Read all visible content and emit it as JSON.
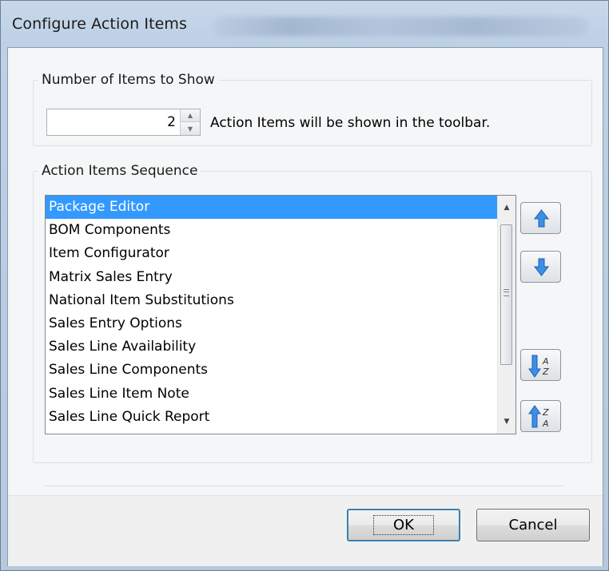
{
  "window": {
    "title": "Configure Action Items"
  },
  "number_group": {
    "legend": "Number of Items to Show",
    "count_value": "2",
    "caption": "Action Items will be shown in the toolbar."
  },
  "sequence_group": {
    "legend": "Action Items Sequence",
    "items": [
      "Package Editor",
      "BOM Components",
      "Item Configurator",
      "Matrix Sales Entry",
      "National Item Substitutions",
      "Sales Entry Options",
      "Sales Line Availability",
      "Sales Line Components",
      "Sales Line Item Note",
      "Sales Line Quick Report"
    ],
    "selected_index": 0
  },
  "icons": {
    "move_up": "arrow-up-icon",
    "move_down": "arrow-down-icon",
    "sort_az": "sort-ascending-icon",
    "sort_za": "sort-descending-icon",
    "accent_color": "#3399ff"
  },
  "buttons": {
    "ok": "OK",
    "cancel": "Cancel"
  }
}
